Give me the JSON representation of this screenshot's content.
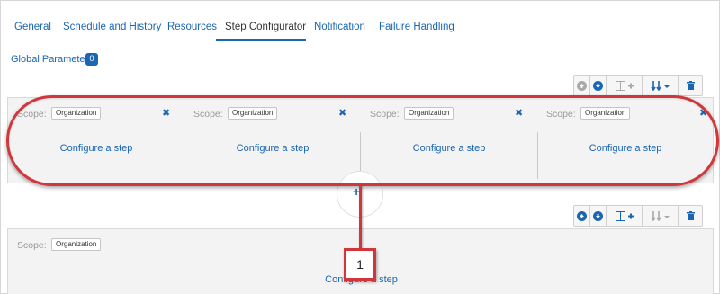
{
  "tabs": [
    {
      "label": "General"
    },
    {
      "label": "Schedule and History"
    },
    {
      "label": "Resources"
    },
    {
      "label": "Step Configurator",
      "active": true
    },
    {
      "label": "Notification"
    },
    {
      "label": "Failure Handling"
    }
  ],
  "global_parameters": {
    "label": "Global Parameters",
    "count": "0"
  },
  "scope": {
    "label": "Scope:",
    "value": "Organization"
  },
  "configure_label": "Configure a step",
  "close_glyph": "✖",
  "add_glyph": "+",
  "callout": {
    "number": "1"
  },
  "toolbar_icons": [
    "move-up-icon",
    "move-down-icon",
    "add-column-icon",
    "sort-icon",
    "trash-icon"
  ],
  "colors": {
    "accent": "#1a66b2",
    "highlight": "#d1363a",
    "panel_bg": "#f3f3f3"
  }
}
